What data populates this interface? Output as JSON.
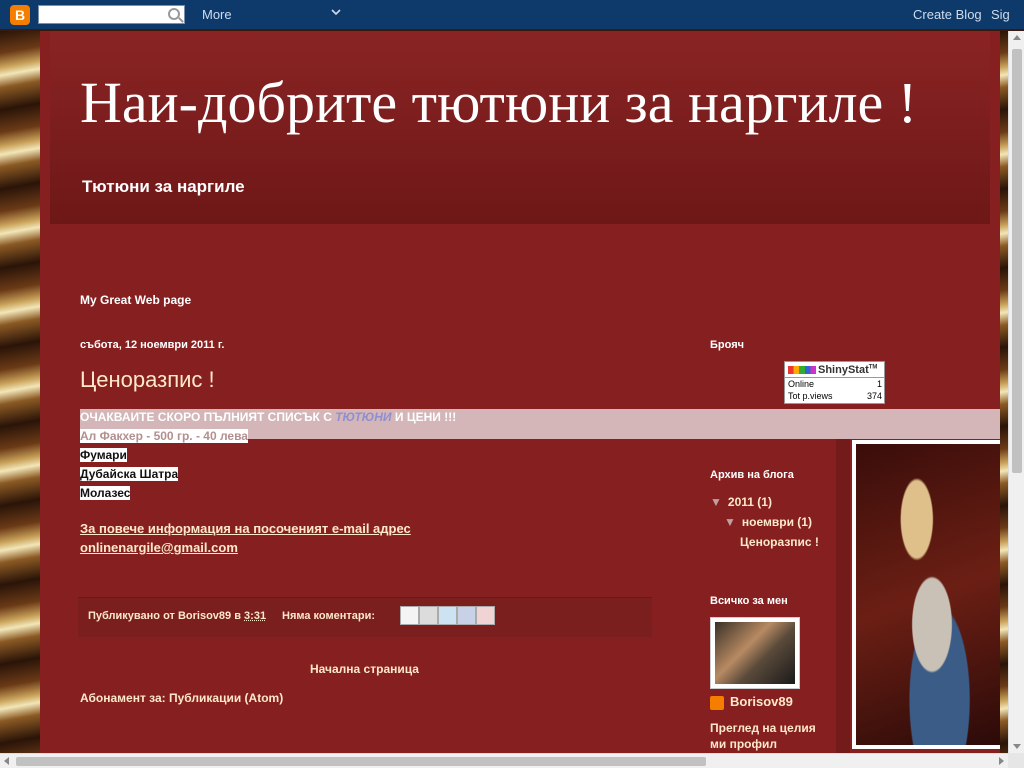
{
  "navbar": {
    "logo_letter": "B",
    "more_label": "More",
    "create_blog_label": "Create Blog",
    "sign_in_label": "Sig"
  },
  "header": {
    "title": "Наи-добрите тютюни за наргиле !",
    "description": "Тютюни за наргиле"
  },
  "web_page_label": "My Great Web page",
  "post": {
    "date": "събота, 12 ноември 2011 г.",
    "title": "Ценоразпис !",
    "line1_prefix": "ОЧАКВАИТЕ СКОРО ПЪЛНИЯТ СПИСЪК С ",
    "line1_emphasis": "ТЮТЮНИ",
    "line1_suffix": " И ЦЕНИ !!!",
    "line2": "Ал Факхер - 500 гр. - 40 лева",
    "line3": "Фумари",
    "line4": "Дубайска Шатра",
    "line5": "Молазес",
    "info_text": "За повече информация на посоченият e-mail адрес",
    "email": "onlinenargile@gmail.com"
  },
  "post_footer": {
    "published_by": "Публикувано от ",
    "author": "Borisov89",
    "at": " в ",
    "time": "3:31",
    "comments": "Няма коментари:"
  },
  "home_link": "Начална страница",
  "subscribe": {
    "prefix": "Абонамент за: ",
    "link": "Публикации (Atom)"
  },
  "sidebar": {
    "counter_heading": "Брояч",
    "counter": {
      "brand": "ShinyStat",
      "tm": "TM",
      "online_label": "Online",
      "online_value": "1",
      "views_label": "Tot p.views",
      "views_value": "374"
    },
    "archive_heading": "Архив на блога",
    "archive": {
      "year": "2011",
      "year_count": "(1)",
      "month": "ноември",
      "month_count": "(1)",
      "post": "Ценоразпис !",
      "toggle": "▼"
    },
    "about_heading": "Всичко за мен",
    "profile_name": "Borisov89",
    "profile_view": "Преглед на целия ми профил"
  }
}
